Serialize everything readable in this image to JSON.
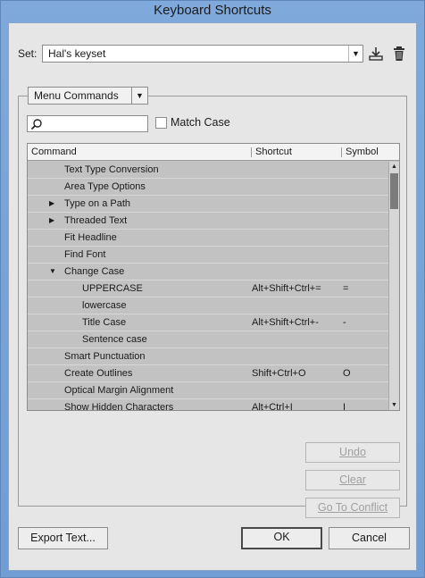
{
  "window": {
    "title": "Keyboard Shortcuts"
  },
  "set": {
    "label": "Set:",
    "value": "Hal's keyset",
    "icons": [
      "save-icon",
      "trash-icon"
    ]
  },
  "menu_selector": {
    "value": "Menu Commands"
  },
  "search": {
    "value": "",
    "placeholder": ""
  },
  "match_case": {
    "label": "Match Case",
    "checked": false
  },
  "table": {
    "headers": {
      "command": "Command",
      "shortcut": "Shortcut",
      "symbol": "Symbol"
    },
    "rows": [
      {
        "level": 1,
        "toggle": "",
        "command": "Text Type Conversion",
        "shortcut": "",
        "symbol": ""
      },
      {
        "level": 1,
        "toggle": "",
        "command": "Area Type Options",
        "shortcut": "",
        "symbol": ""
      },
      {
        "level": 1,
        "toggle": "▶",
        "command": "Type on a Path",
        "shortcut": "",
        "symbol": ""
      },
      {
        "level": 1,
        "toggle": "▶",
        "command": "Threaded Text",
        "shortcut": "",
        "symbol": ""
      },
      {
        "level": 1,
        "toggle": "",
        "command": "Fit Headline",
        "shortcut": "",
        "symbol": ""
      },
      {
        "level": 1,
        "toggle": "",
        "command": "Find Font",
        "shortcut": "",
        "symbol": ""
      },
      {
        "level": 1,
        "toggle": "▼",
        "command": "Change Case",
        "shortcut": "",
        "symbol": ""
      },
      {
        "level": 2,
        "toggle": "",
        "command": "UPPERCASE",
        "shortcut": "Alt+Shift+Ctrl+=",
        "symbol": "="
      },
      {
        "level": 2,
        "toggle": "",
        "command": "lowercase",
        "shortcut": "",
        "symbol": ""
      },
      {
        "level": 2,
        "toggle": "",
        "command": "Title Case",
        "shortcut": "Alt+Shift+Ctrl+-",
        "symbol": "-"
      },
      {
        "level": 2,
        "toggle": "",
        "command": "Sentence case",
        "shortcut": "",
        "symbol": ""
      },
      {
        "level": 1,
        "toggle": "",
        "command": "Smart Punctuation",
        "shortcut": "",
        "symbol": ""
      },
      {
        "level": 1,
        "toggle": "",
        "command": "Create Outlines",
        "shortcut": "Shift+Ctrl+O",
        "symbol": "O"
      },
      {
        "level": 1,
        "toggle": "",
        "command": "Optical Margin Alignment",
        "shortcut": "",
        "symbol": ""
      },
      {
        "level": 1,
        "toggle": "",
        "command": "Show Hidden Characters",
        "shortcut": "Alt+Ctrl+I",
        "symbol": "I"
      }
    ]
  },
  "actions": {
    "undo": "Undo",
    "clear": "Clear",
    "go_to_conflict": "Go To Conflict"
  },
  "footer": {
    "export": "Export Text...",
    "ok": "OK",
    "cancel": "Cancel"
  }
}
